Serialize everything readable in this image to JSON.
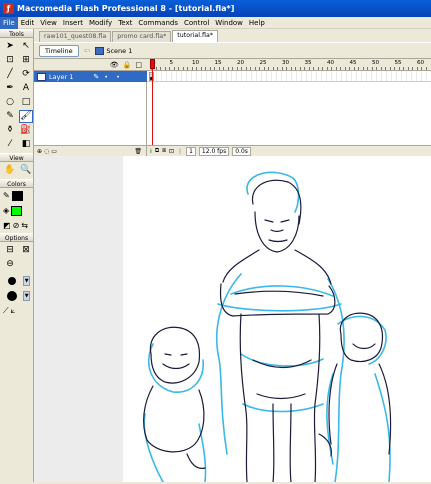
{
  "window": {
    "title": "Macromedia Flash Professional 8 - [tutorial.fla*]"
  },
  "menu": [
    "File",
    "Edit",
    "View",
    "Insert",
    "Modify",
    "Text",
    "Commands",
    "Control",
    "Window",
    "Help"
  ],
  "tools_panel": {
    "header": "Tools",
    "tools": [
      {
        "name": "arrow",
        "glyph": "➤"
      },
      {
        "name": "subselect",
        "glyph": "↖"
      },
      {
        "name": "free-transform",
        "glyph": "⊡"
      },
      {
        "name": "fill-transform",
        "glyph": "⊞"
      },
      {
        "name": "line",
        "glyph": "╱"
      },
      {
        "name": "lasso",
        "glyph": "⟳"
      },
      {
        "name": "pen",
        "glyph": "✒"
      },
      {
        "name": "text",
        "glyph": "A"
      },
      {
        "name": "oval",
        "glyph": "○"
      },
      {
        "name": "rectangle",
        "glyph": "□"
      },
      {
        "name": "pencil",
        "glyph": "✎"
      },
      {
        "name": "brush",
        "glyph": "🖌"
      },
      {
        "name": "ink-bottle",
        "glyph": "⚱"
      },
      {
        "name": "paint-bucket",
        "glyph": "⛽"
      },
      {
        "name": "eyedropper",
        "glyph": "⁄"
      },
      {
        "name": "eraser",
        "glyph": "◧"
      }
    ],
    "view_header": "View",
    "view_tools": [
      {
        "name": "hand",
        "glyph": "✋"
      },
      {
        "name": "zoom",
        "glyph": "🔍"
      }
    ],
    "colors_header": "Colors",
    "stroke_color": "#000000",
    "fill_color": "#00ff00",
    "options_header": "Options"
  },
  "doc_tabs": [
    "raw101_quest08.fla",
    "promo card.fla*",
    "tutorial.fla*"
  ],
  "active_tab_index": 2,
  "edit_bar": {
    "timeline_button": "Timeline",
    "scene_label": "Scene 1"
  },
  "timeline": {
    "layer_name": "Layer 1",
    "frame_numbers": [
      "5",
      "10",
      "15",
      "20",
      "25",
      "30",
      "35",
      "40",
      "45",
      "50",
      "55",
      "60"
    ],
    "current_frame": "1",
    "frame_rate": "12.0 fps",
    "elapsed": "0.0s"
  },
  "colors": {
    "selection": "#316ac5",
    "title_bar": "#0a5fd8",
    "sketch_blue": "#3ab8e8",
    "sketch_ink": "#1b1b3a"
  }
}
